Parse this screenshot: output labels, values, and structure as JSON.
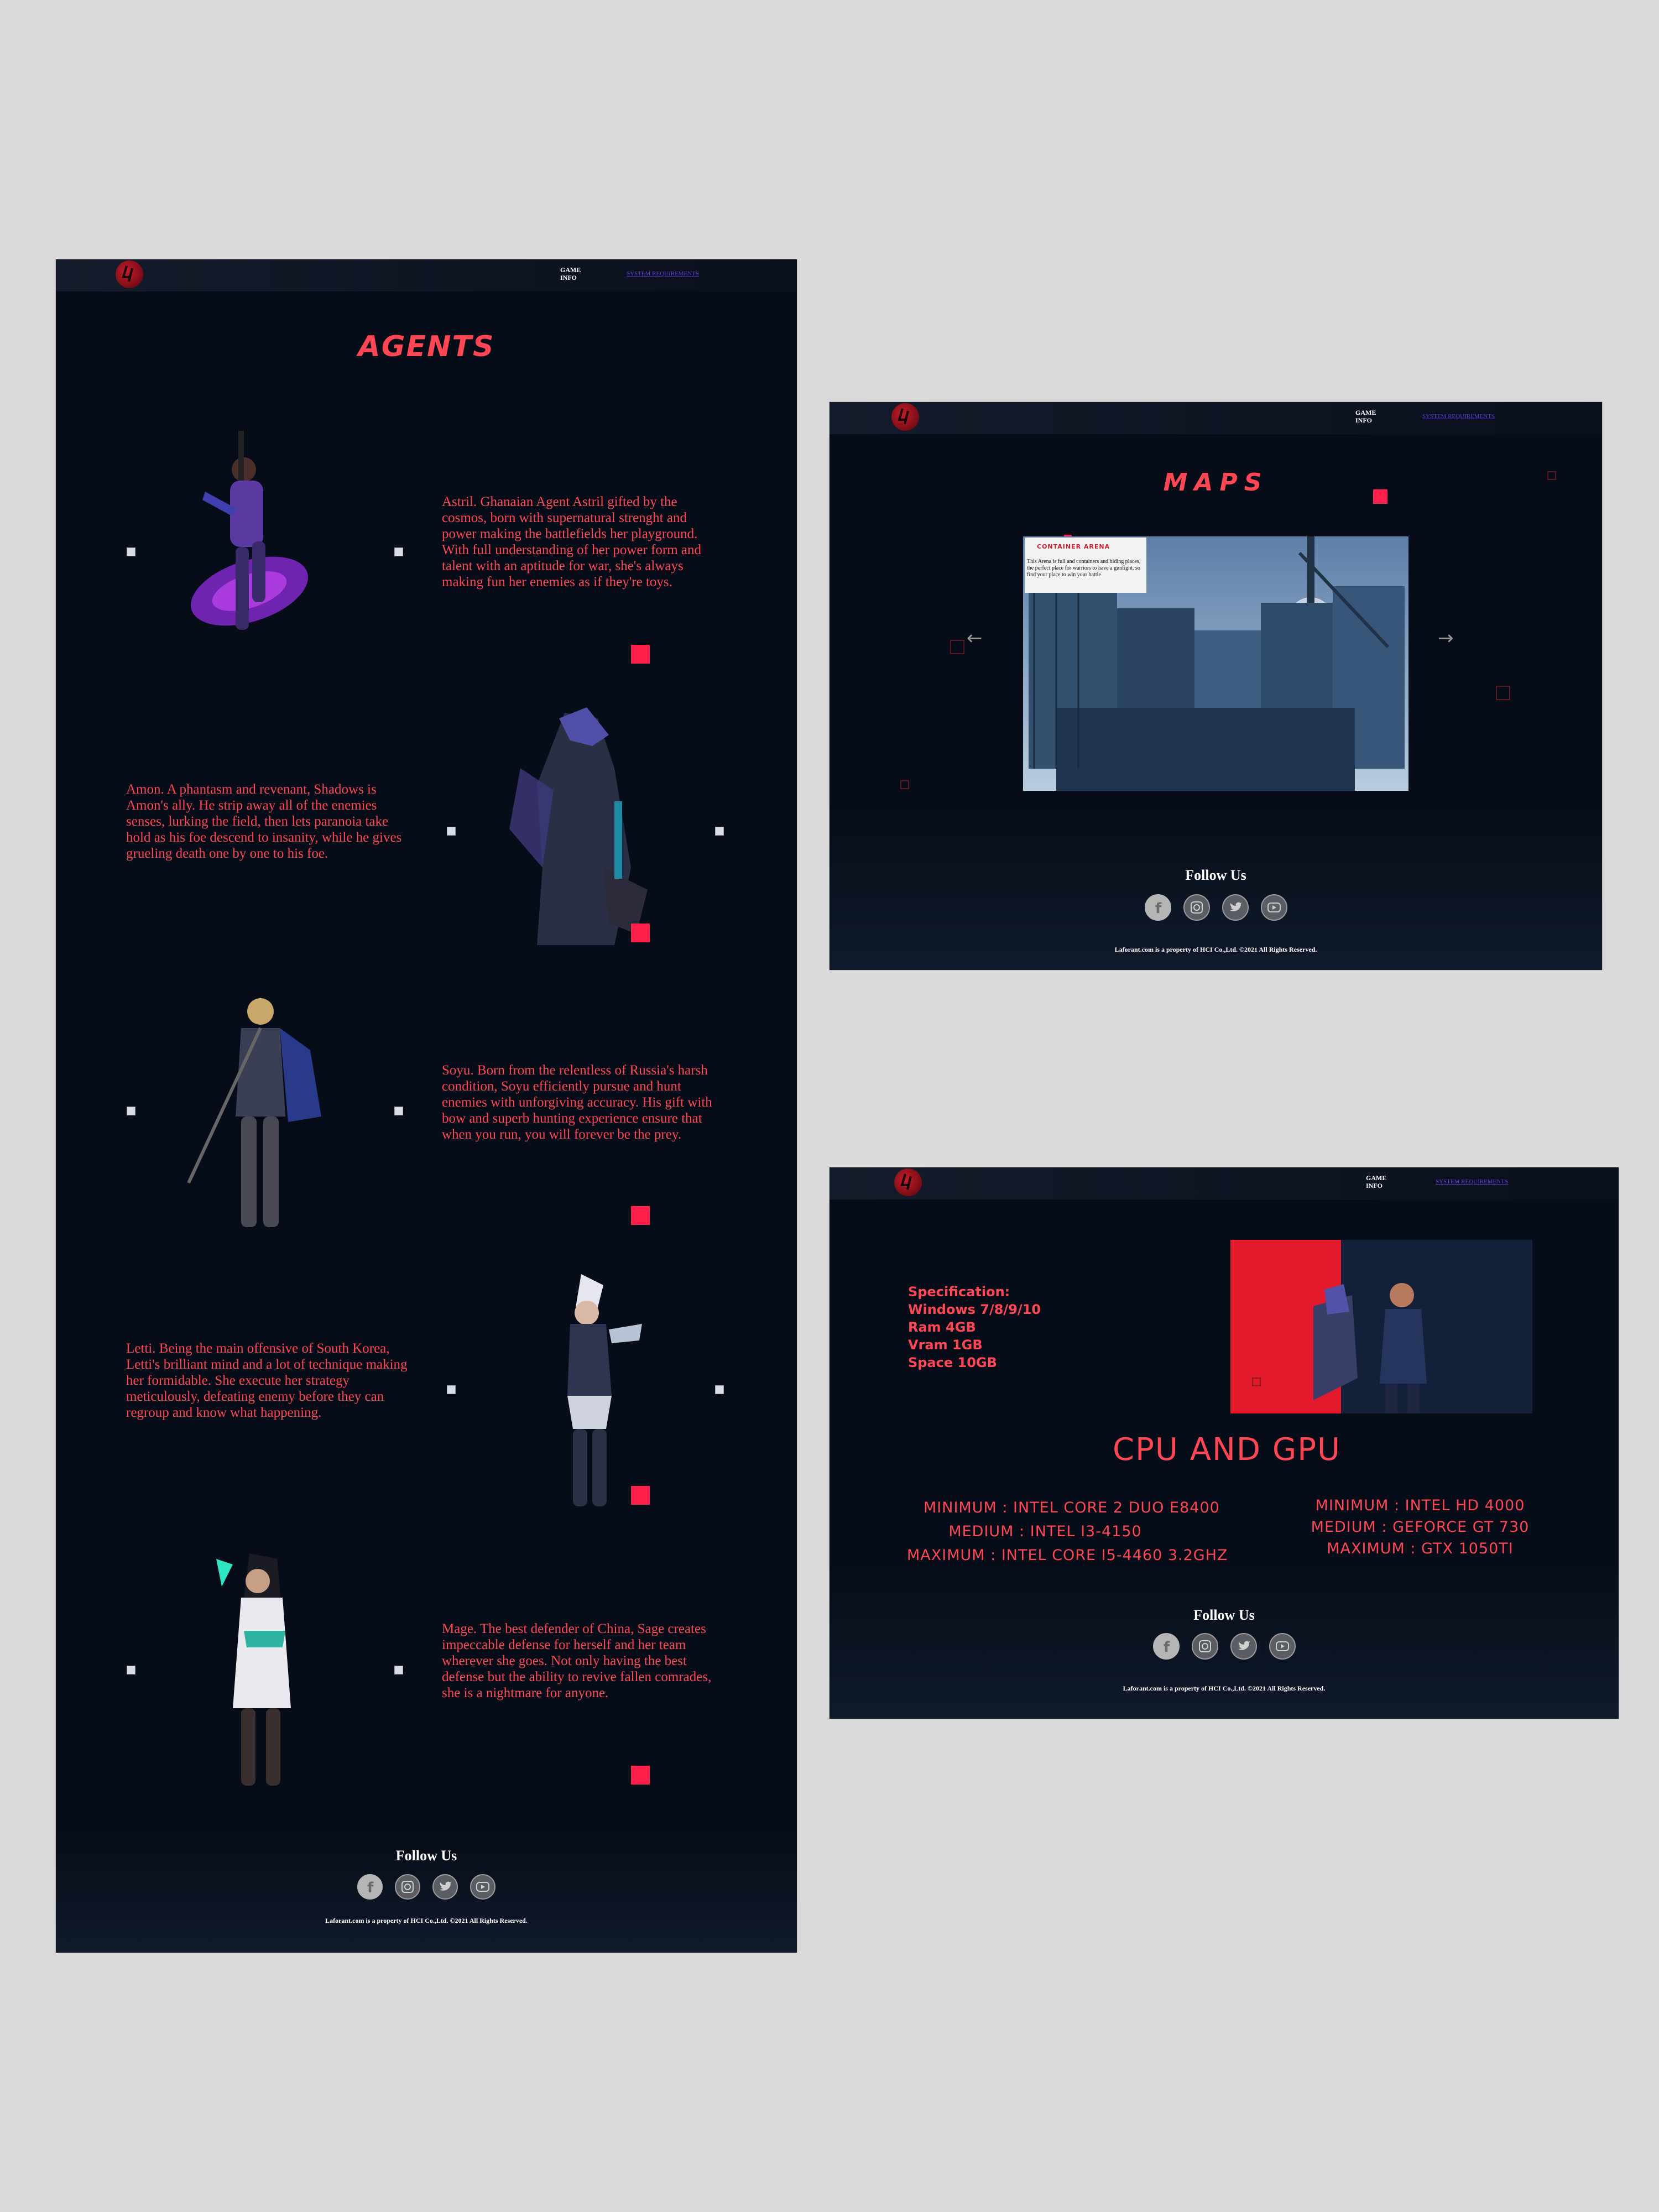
{
  "nav": {
    "game_info": "GAME INFO",
    "system_requirements": "SYSTEM REQUIREMENTS"
  },
  "agents_page": {
    "title": "AGENTS",
    "agents": [
      {
        "text": "Astril. Ghanaian Agent Astril gifted by the cosmos, born with supernatural strenght and power making the battlefields her playground. With full understanding of her power form and talent with an aptitude for war, she's always making fun her enemies as if they're toys."
      },
      {
        "text": "Amon. A phantasm and revenant, Shadows is Amon's ally. He strip away all of the enemies senses, lurking the field, then lets paranoia take hold as his foe descend to insanity, while he gives grueling death one by one to his foe."
      },
      {
        "text": "Soyu. Born from the relentless of Russia's harsh condition, Soyu efficiently pursue and hunt enemies with unforgiving accuracy. His gift with bow and superb hunting experience ensure that when you run, you will forever be the prey."
      },
      {
        "text": "Letti. Being the main offensive of South Korea, Letti's brilliant mind and a lot of technique making her formidable. She execute her strategy meticulously, defeating enemy before they can regroup and know what happening."
      },
      {
        "text": "Mage. The best defender of China, Sage creates impeccable defense for herself and her team wherever she goes. Not only having the best defense but the ability to revive fallen comrades, she is a nightmare for anyone."
      }
    ]
  },
  "maps_page": {
    "title": "MAPS",
    "map_card": {
      "name": "CONTAINER ARENA",
      "description": "This Arena is full and containers and hiding places, the perfect place for warriors to have a gunfight, so find your place to win your battle"
    }
  },
  "sysreq_page": {
    "spec_label": "Specification:",
    "spec_lines": [
      "Windows 7/8/9/10",
      "Ram 4GB",
      "Vram 1GB",
      "Space 10GB"
    ],
    "title": "CPU AND GPU",
    "cpu": [
      "MINIMUM : INTEL CORE 2 DUO E8400",
      "MEDIUM : INTEL I3-4150",
      "MAXIMUM : INTEL CORE I5-4460 3.2GHZ"
    ],
    "gpu": [
      "MINIMUM : INTEL HD 4000",
      "MEDIUM : GEFORCE GT 730",
      "MAXIMUM : GTX 1050TI"
    ]
  },
  "footer": {
    "follow_us": "Follow Us",
    "copyright": "Laforant.com is a property of HCI Co.,Ltd. ©2021 All Rights Reserved."
  },
  "colors": {
    "accent": "#ff4655",
    "background": "#070d18",
    "red_square": "#ff1f4b"
  }
}
